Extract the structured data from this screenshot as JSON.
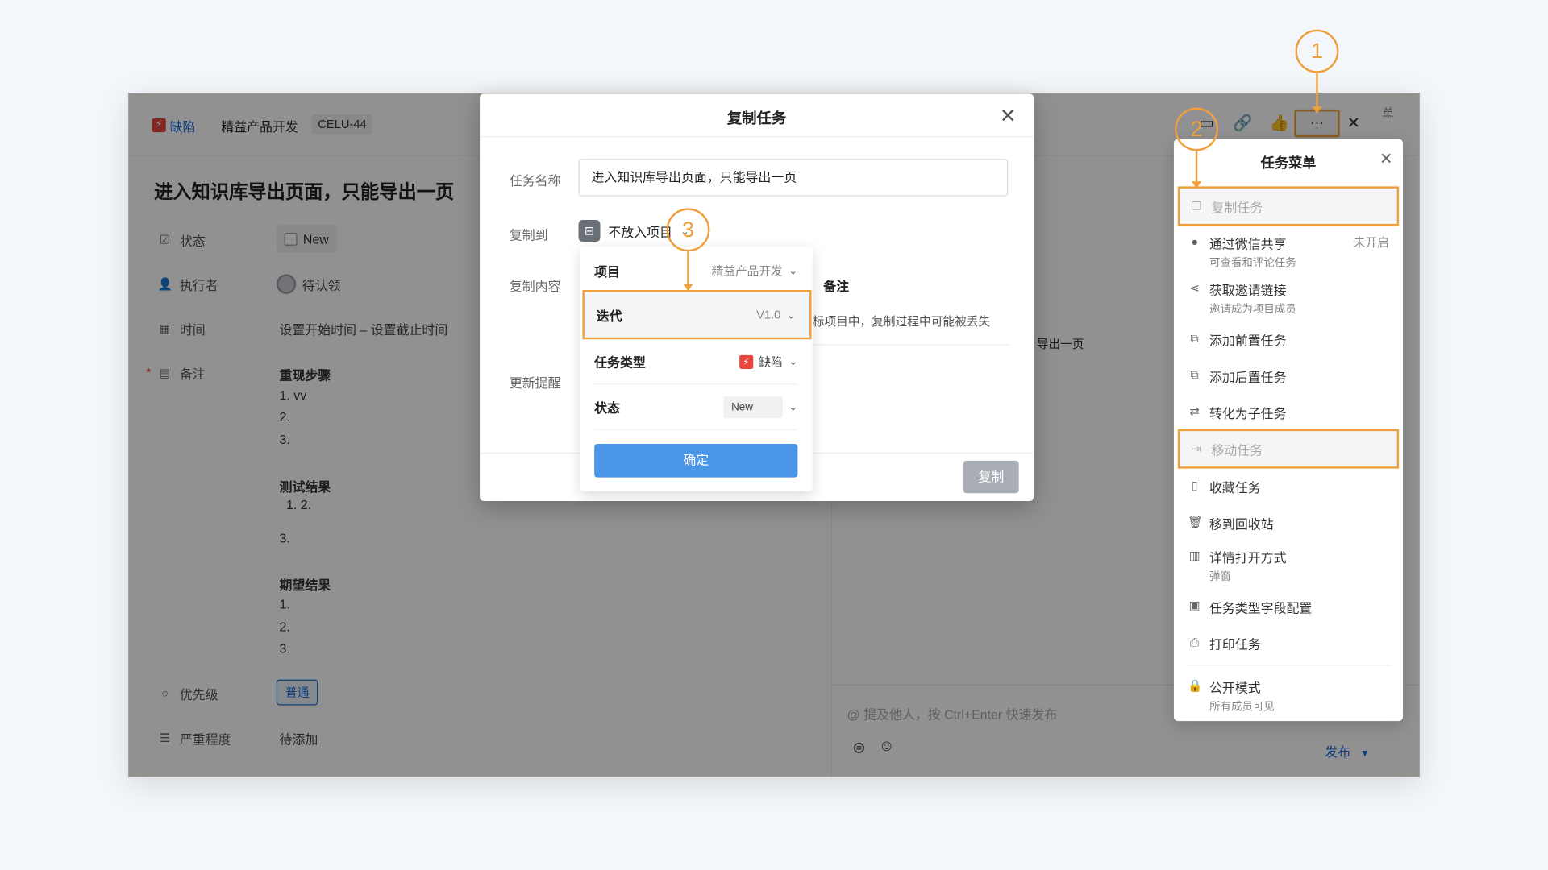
{
  "header": {
    "type_label": "缺陷",
    "project_name": "精益产品开发",
    "task_id": "CELU-44",
    "header_more": "···"
  },
  "task": {
    "title": "进入知识库导出页面，只能导出一页",
    "fields": {
      "status_label": "状态",
      "status_value": "New",
      "assignee_label": "执行者",
      "assignee_value": "待认领",
      "time_label": "时间",
      "time_value": "设置开始时间 – 设置截止时间",
      "note_label": "备注",
      "priority_label": "优先级",
      "priority_value": "普通",
      "severity_label": "严重程度",
      "severity_value": "待添加"
    },
    "note": {
      "h1": "重现步骤",
      "s1": "1. vv",
      "s2": "2.",
      "s3": "3.",
      "h2": "测试结果",
      "t1": "1. 2.",
      "t2": "3.",
      "h3": "期望结果",
      "e1": "1.",
      "e2": "2.",
      "e3": "3."
    }
  },
  "right_panel": {
    "partial_text1": "标项目中，复制过程中可能被丢失",
    "partial_text2": "导出一页",
    "comment_placeholder": "@ 提及他人，按 Ctrl+Enter 快速发布",
    "publish_label": "发布",
    "top_right_fragment": "单"
  },
  "menu": {
    "title": "任务菜单",
    "items": [
      {
        "label": "复制任务",
        "sub": "",
        "right": "",
        "icon": "copy-icon"
      },
      {
        "label": "通过微信共享",
        "sub": "可查看和评论任务",
        "right": "未开启",
        "icon": "wechat-icon"
      },
      {
        "label": "获取邀请链接",
        "sub": "邀请成为项目成员",
        "right": "",
        "icon": "share-icon"
      },
      {
        "label": "添加前置任务",
        "sub": "",
        "right": "",
        "icon": "predecessor-icon"
      },
      {
        "label": "添加后置任务",
        "sub": "",
        "right": "",
        "icon": "successor-icon"
      },
      {
        "label": "转化为子任务",
        "sub": "",
        "right": "",
        "icon": "convert-icon"
      },
      {
        "label": "移动任务",
        "sub": "",
        "right": "",
        "icon": "move-icon"
      },
      {
        "label": "收藏任务",
        "sub": "",
        "right": "",
        "icon": "bookmark-icon"
      },
      {
        "label": "移到回收站",
        "sub": "",
        "right": "",
        "icon": "trash-icon"
      },
      {
        "label": "详情打开方式",
        "sub": "弹窗",
        "right": "",
        "icon": "layout-icon"
      },
      {
        "label": "任务类型字段配置",
        "sub": "",
        "right": "",
        "icon": "field-config-icon"
      },
      {
        "label": "打印任务",
        "sub": "",
        "right": "",
        "icon": "print-icon"
      },
      {
        "label": "公开模式",
        "sub": "所有成员可见",
        "right": "",
        "icon": "lock-icon"
      }
    ]
  },
  "dialog": {
    "title": "复制任务",
    "name_label": "任务名称",
    "name_value": "进入知识库导出页面，只能导出一页",
    "copy_to_label": "复制到",
    "copy_to_value": "不放入项目",
    "content_label": "复制内容",
    "content_note": "备注",
    "reminder_label": "更新提醒",
    "copy_button": "复制"
  },
  "popover": {
    "project_label": "项目",
    "project_value": "精益产品开发",
    "iteration_label": "迭代",
    "iteration_value": "V1.0",
    "type_label": "任务类型",
    "type_value": "缺陷",
    "state_label": "状态",
    "state_value": "New",
    "confirm_label": "确定"
  },
  "annotations": {
    "c1": "1",
    "c2": "2",
    "c3": "3"
  },
  "colors": {
    "accent_blue": "#1b6ddc",
    "annotation_orange": "#f0a03a",
    "bug_red": "#e8453c"
  }
}
